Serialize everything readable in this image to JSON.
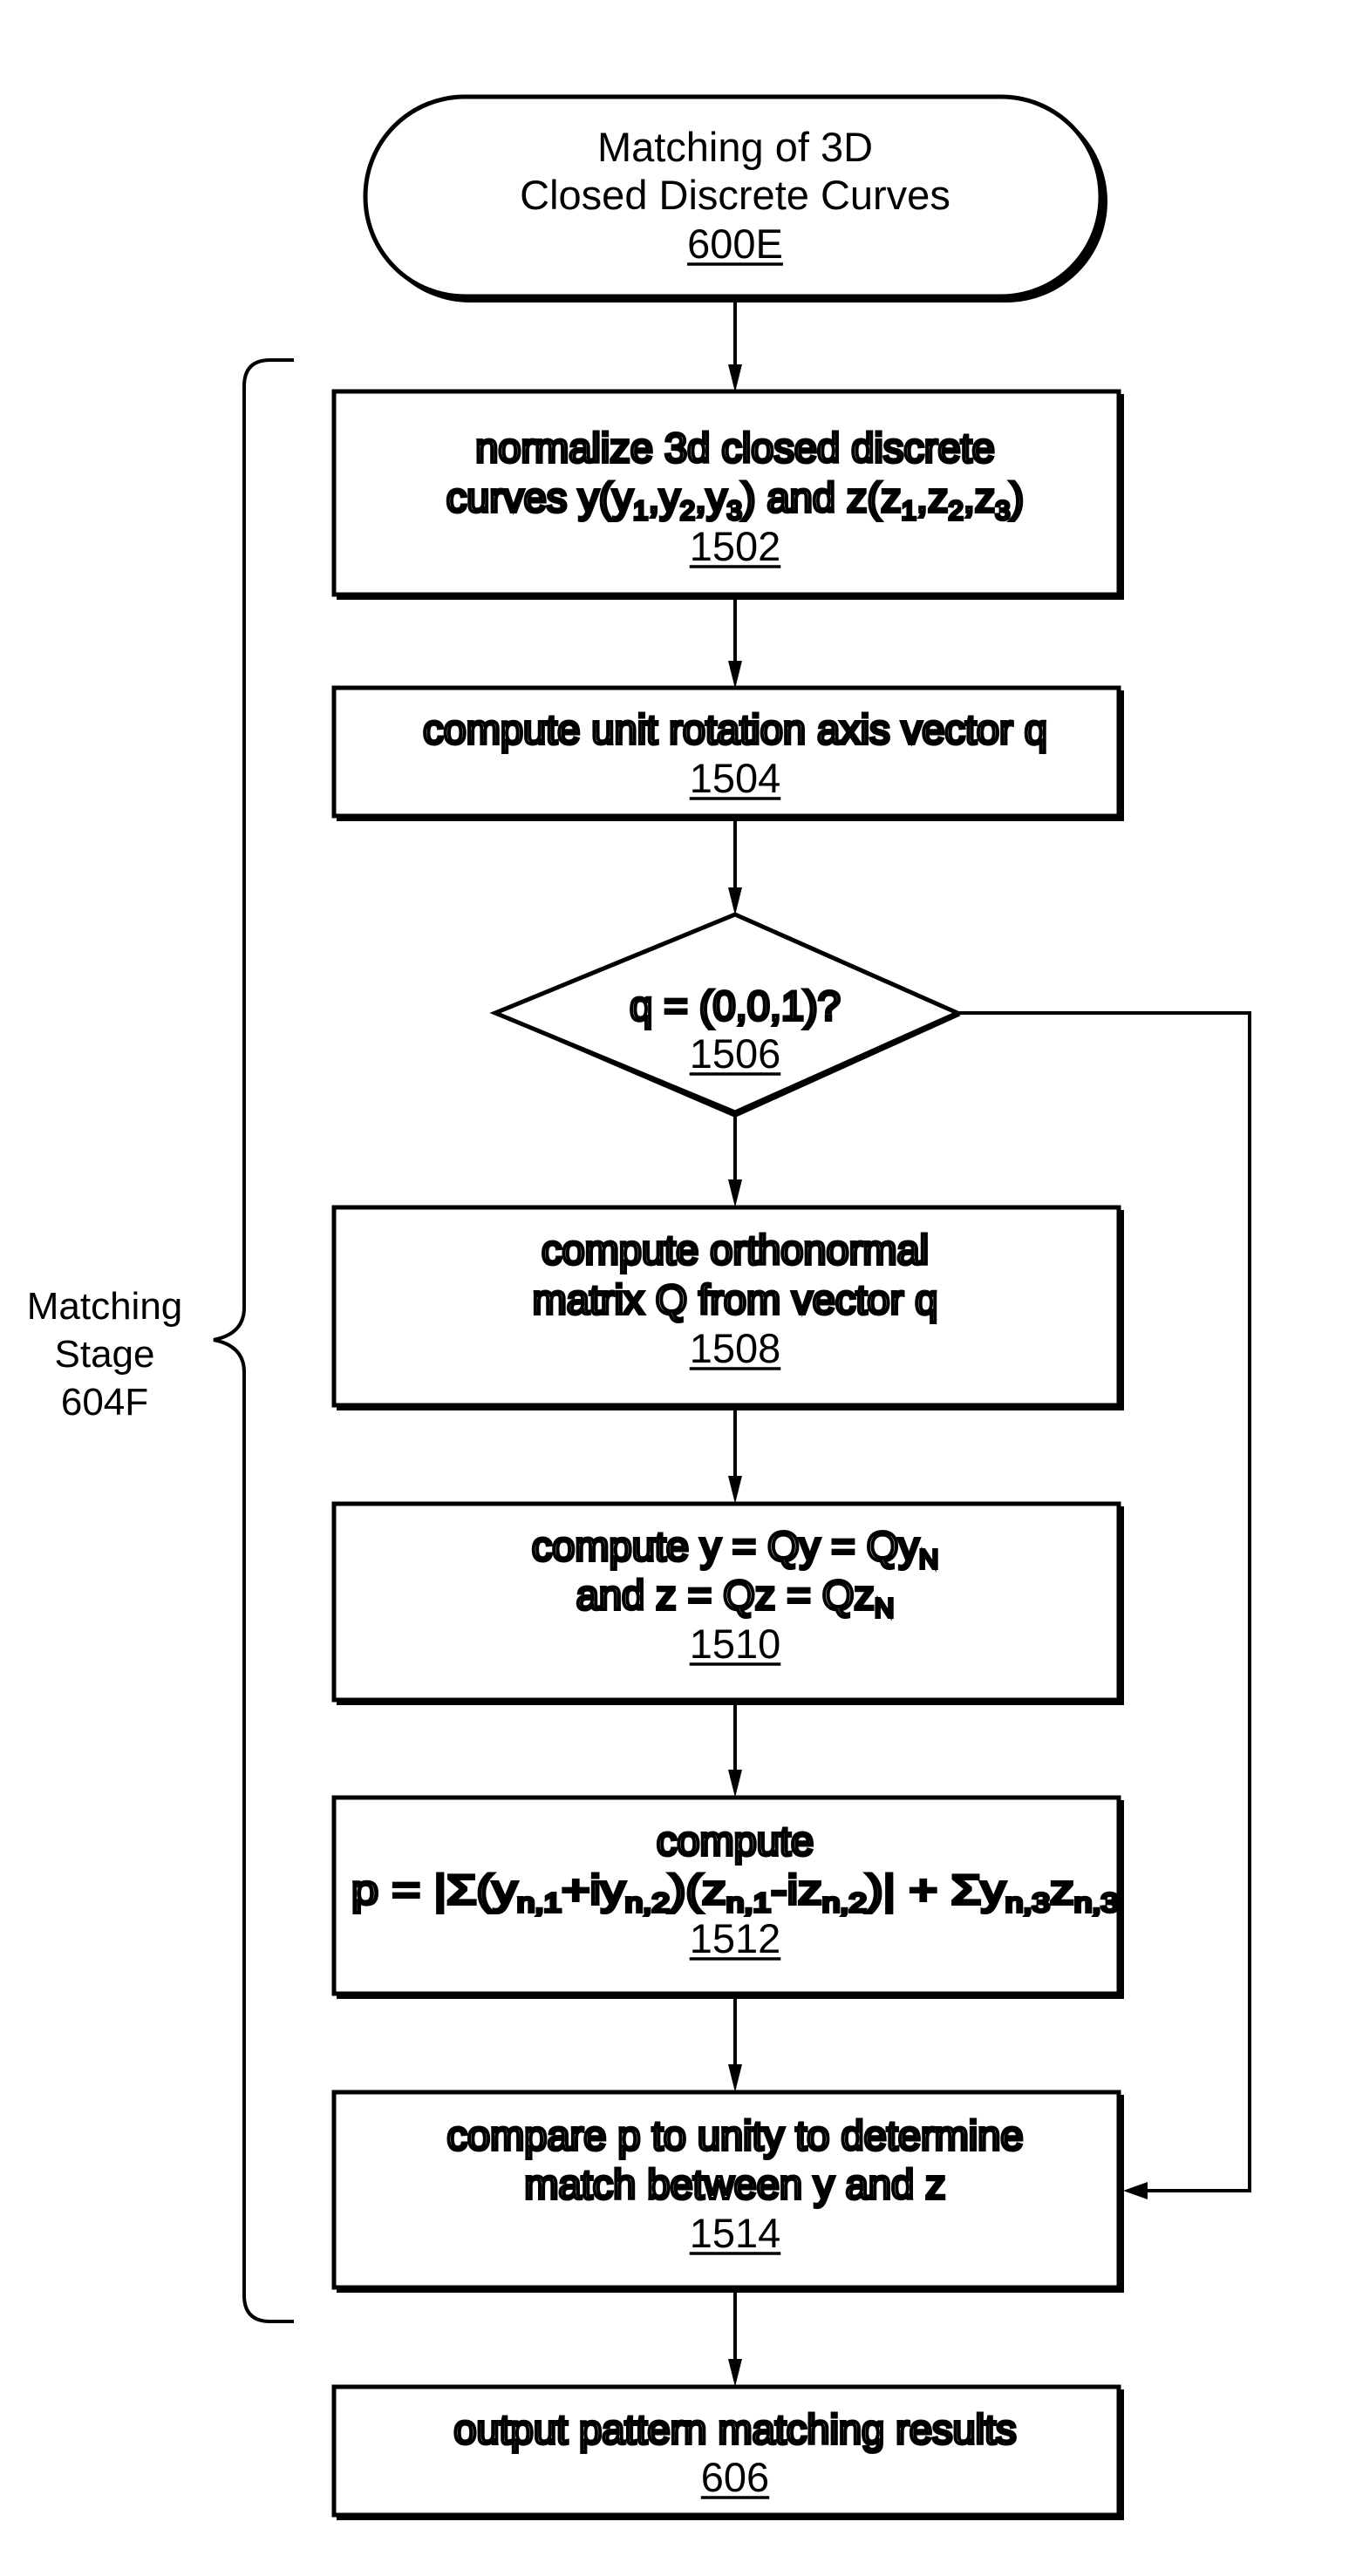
{
  "diagram": {
    "type": "flowchart",
    "start": {
      "id": "600E",
      "shape": "terminal",
      "lines": [
        "Matching of 3D",
        "Closed Discrete Curves"
      ],
      "ref": "600E"
    },
    "steps": [
      {
        "id": "1502",
        "shape": "process",
        "lines": [
          [
            {
              "t": "normalize 3d closed discrete"
            }
          ],
          [
            {
              "t": "curves y(y"
            },
            {
              "t": "1",
              "sub": true
            },
            {
              "t": ",y"
            },
            {
              "t": "2",
              "sub": true
            },
            {
              "t": ",y"
            },
            {
              "t": "3",
              "sub": true
            },
            {
              "t": ") and z(z"
            },
            {
              "t": "1",
              "sub": true
            },
            {
              "t": ",z"
            },
            {
              "t": "2",
              "sub": true
            },
            {
              "t": ",z"
            },
            {
              "t": "3",
              "sub": true
            },
            {
              "t": ")"
            }
          ]
        ],
        "ref": "1502"
      },
      {
        "id": "1504",
        "shape": "process",
        "lines": [
          [
            {
              "t": "compute unit rotation axis vector q"
            }
          ]
        ],
        "ref": "1504"
      },
      {
        "id": "1506",
        "shape": "decision",
        "lines": [
          [
            {
              "t": "q = (0,0,1)?"
            }
          ]
        ],
        "ref": "1506"
      },
      {
        "id": "1508",
        "shape": "process",
        "lines": [
          [
            {
              "t": "compute orthonormal"
            }
          ],
          [
            {
              "t": "matrix Q from vector q"
            }
          ]
        ],
        "ref": "1508"
      },
      {
        "id": "1510",
        "shape": "process",
        "lines": [
          [
            {
              "t": "compute  y = Qy = Qy"
            },
            {
              "t": "N",
              "sub": true
            }
          ],
          [
            {
              "t": "and z = Qz = Qz"
            },
            {
              "t": "N",
              "sub": true
            }
          ]
        ],
        "ref": "1510"
      },
      {
        "id": "1512",
        "shape": "process",
        "lines": [
          [
            {
              "t": "compute"
            }
          ],
          [
            {
              "t": "p = |Σ(y"
            },
            {
              "t": "n,1",
              "sub": true
            },
            {
              "t": "+iy"
            },
            {
              "t": "n,2",
              "sub": true
            },
            {
              "t": ")(z"
            },
            {
              "t": "n,1",
              "sub": true
            },
            {
              "t": "-iz"
            },
            {
              "t": "n,2",
              "sub": true
            },
            {
              "t": ")| + Σy"
            },
            {
              "t": "n,3",
              "sub": true
            },
            {
              "t": "z"
            },
            {
              "t": "n,3",
              "sub": true
            }
          ]
        ],
        "ref": "1512"
      },
      {
        "id": "1514",
        "shape": "process",
        "lines": [
          [
            {
              "t": "compare p to unity to determine"
            }
          ],
          [
            {
              "t": "match between y and z"
            }
          ]
        ],
        "ref": "1514"
      },
      {
        "id": "606",
        "shape": "process",
        "lines": [
          [
            {
              "t": "output pattern matching results"
            }
          ]
        ],
        "ref": "606"
      }
    ],
    "edges": [
      {
        "from": "600E",
        "to": "1502"
      },
      {
        "from": "1502",
        "to": "1504"
      },
      {
        "from": "1504",
        "to": "1506"
      },
      {
        "from": "1506",
        "to": "1508",
        "label": ""
      },
      {
        "from": "1506",
        "to": "1514",
        "label": ""
      },
      {
        "from": "1508",
        "to": "1510"
      },
      {
        "from": "1510",
        "to": "1512"
      },
      {
        "from": "1512",
        "to": "1514"
      },
      {
        "from": "1514",
        "to": "606"
      }
    ],
    "group": {
      "lines": [
        "Matching",
        "Stage",
        "604F"
      ],
      "spans": [
        "1502",
        "1514"
      ]
    }
  }
}
